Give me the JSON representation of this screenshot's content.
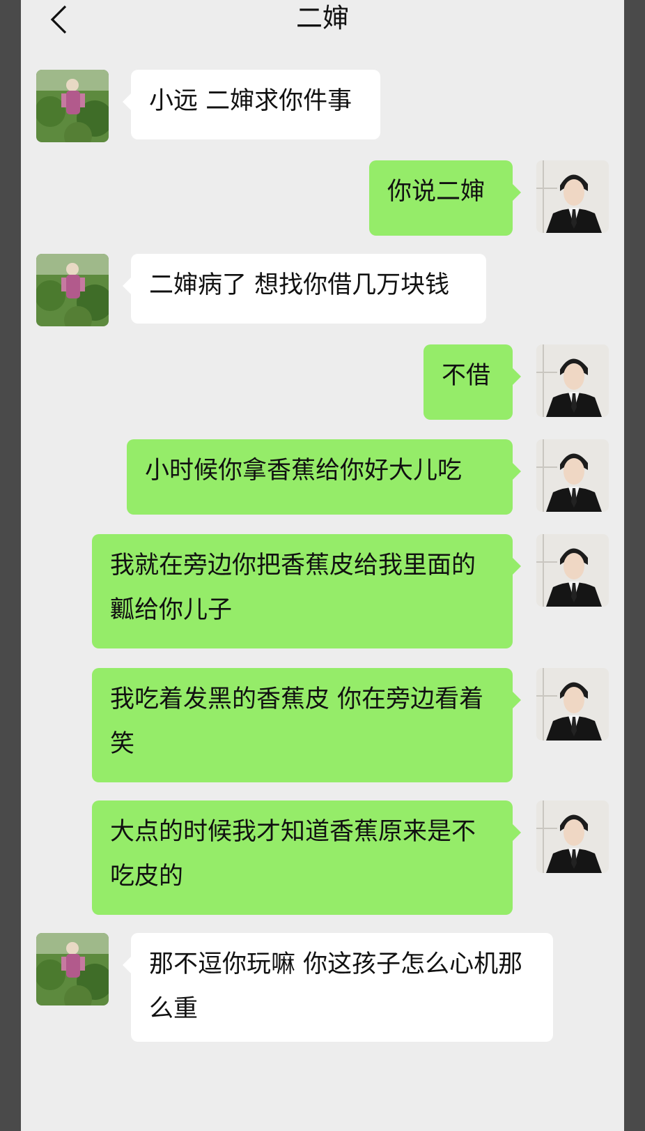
{
  "header": {
    "title": "二婶",
    "back_icon": "chevron-left-icon"
  },
  "contact": {
    "name": "二婶"
  },
  "messages": [
    {
      "from": "contact",
      "text": "小远 二婶求你件事"
    },
    {
      "from": "me",
      "text": "你说二婶"
    },
    {
      "from": "contact",
      "text": "二婶病了 想找你借几万块钱"
    },
    {
      "from": "me",
      "text": "不借"
    },
    {
      "from": "me",
      "text": "小时候你拿香蕉给你好大儿吃"
    },
    {
      "from": "me",
      "text": "我就在旁边你把香蕉皮给我里面的瓤给你儿子"
    },
    {
      "from": "me",
      "text": "我吃着发黑的香蕉皮 你在旁边看着笑"
    },
    {
      "from": "me",
      "text": "大点的时候我才知道香蕉原来是不吃皮的"
    },
    {
      "from": "contact",
      "text": "那不逗你玩嘛 你这孩子怎么心机那么重"
    }
  ],
  "colors": {
    "chat_bg": "#ededed",
    "outgoing_bubble": "#95ec69",
    "incoming_bubble": "#ffffff",
    "frame": "#4a4a4a"
  }
}
